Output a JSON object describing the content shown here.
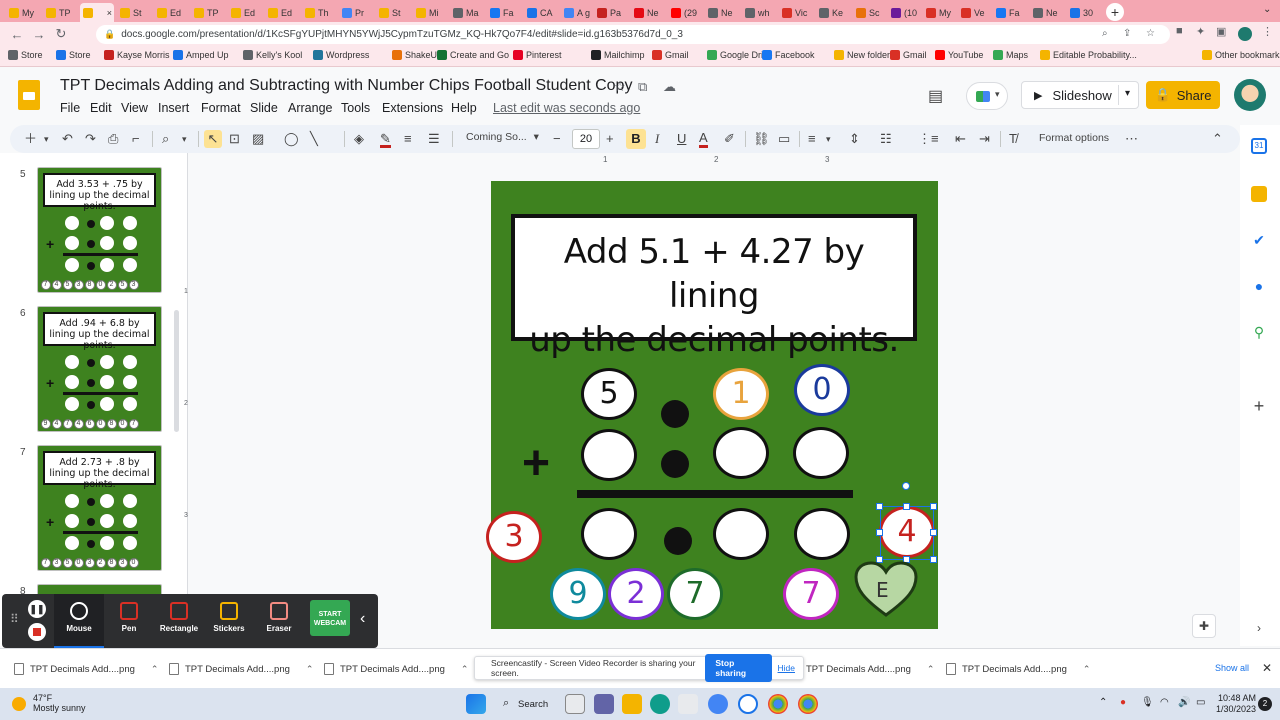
{
  "browser": {
    "tabs": [
      {
        "label": "My",
        "color": "#f4b400"
      },
      {
        "label": "TP",
        "color": "#f4b400"
      },
      {
        "label": "",
        "color": "#f4b400",
        "active": true
      },
      {
        "label": "St",
        "color": "#f4b400"
      },
      {
        "label": "Ed",
        "color": "#f4b400"
      },
      {
        "label": "TP",
        "color": "#f4b400"
      },
      {
        "label": "Ed",
        "color": "#f4b400"
      },
      {
        "label": "Ed",
        "color": "#f4b400"
      },
      {
        "label": "Th",
        "color": "#f4b400"
      },
      {
        "label": "Pr",
        "color": "#4285f4"
      },
      {
        "label": "St",
        "color": "#f4b400"
      },
      {
        "label": "Mi",
        "color": "#f4b400"
      },
      {
        "label": "Ma",
        "color": "#5f6368"
      },
      {
        "label": "Fa",
        "color": "#1877f2"
      },
      {
        "label": "CA",
        "color": "#1a73e8"
      },
      {
        "label": "A g",
        "color": "#4285f4"
      },
      {
        "label": "Pa",
        "color": "#c5221f"
      },
      {
        "label": "Ne",
        "color": "#e50914"
      },
      {
        "label": "(29",
        "color": "#ff0000"
      },
      {
        "label": "Ne",
        "color": "#5f6368"
      },
      {
        "label": "wh",
        "color": "#5f6368"
      },
      {
        "label": "Vic",
        "color": "#d93025"
      },
      {
        "label": "Ke",
        "color": "#5f6368"
      },
      {
        "label": "Sc",
        "color": "#e8710a"
      },
      {
        "label": "(10",
        "color": "#6a1b9a"
      },
      {
        "label": "My",
        "color": "#d93025"
      },
      {
        "label": "Ve",
        "color": "#d93025"
      },
      {
        "label": "Fa",
        "color": "#1877f2"
      },
      {
        "label": "Ne",
        "color": "#5f6368"
      },
      {
        "label": "30",
        "color": "#1a73e8"
      }
    ],
    "active_tab_close": "×",
    "new_tab": "+",
    "url": "docs.google.com/presentation/d/1KcSFgYUPjtMHYN5YWjJ5CypmTzuTGMz_KQ-Hk7Qo7F4/edit#slide=id.g163b5376d7d_0_3",
    "bookmarks": [
      {
        "label": "Store",
        "color": "#5f6368"
      },
      {
        "label": "Store",
        "color": "#1a73e8"
      },
      {
        "label": "Kayse Morris",
        "color": "#c5221f"
      },
      {
        "label": "Amped Up",
        "color": "#1a73e8"
      },
      {
        "label": "Kelly's Kool",
        "color": "#5f6368"
      },
      {
        "label": "Wordpress",
        "color": "#21759b"
      },
      {
        "label": "ShakeUp",
        "color": "#e8710a"
      },
      {
        "label": "Create and Go",
        "color": "#137333"
      },
      {
        "label": "Pinterest",
        "color": "#e60023"
      },
      {
        "label": "Mailchimp",
        "color": "#202124"
      },
      {
        "label": "Gmail",
        "color": "#d93025"
      },
      {
        "label": "Google Drive",
        "color": "#34a853"
      },
      {
        "label": "Facebook",
        "color": "#1877f2"
      },
      {
        "label": "New folder",
        "color": "#f4b400"
      },
      {
        "label": "Gmail",
        "color": "#d93025"
      },
      {
        "label": "YouTube",
        "color": "#ff0000"
      },
      {
        "label": "Maps",
        "color": "#34a853"
      },
      {
        "label": "Editable Probability...",
        "color": "#f4b400"
      },
      {
        "label": "Other bookmarks",
        "color": "#f4b400"
      }
    ]
  },
  "app": {
    "title": "TPT Decimals Adding and Subtracting with Number Chips Football Student Copy",
    "menus": [
      "File",
      "Edit",
      "View",
      "Insert",
      "Format",
      "Slide",
      "Arrange",
      "Tools",
      "Extensions",
      "Help"
    ],
    "last_edit": "Last edit was seconds ago",
    "slideshow_label": "Slideshow",
    "share_label": "Share",
    "brand_color": "#f4b400"
  },
  "toolbar": {
    "font": "Coming So...",
    "font_size": "20",
    "minus": "−",
    "plus": "+",
    "bold": "B",
    "italic": "I",
    "underline": "U",
    "text_color": "A",
    "format_options": "Format options",
    "more": "⋯"
  },
  "filmstrip": {
    "slides": [
      {
        "number": "5",
        "title": "Add 3.53 + .75 by lining up the decimal points.",
        "chips": [
          "7",
          "4",
          "5",
          "3",
          "8",
          "0",
          "2",
          "5",
          "3"
        ]
      },
      {
        "number": "6",
        "title": "Add .94 + 6.8 by lining up the decimal points.",
        "chips": [
          "9",
          "4",
          "7",
          "4",
          "6",
          "0",
          "8",
          "0",
          "7"
        ]
      },
      {
        "number": "7",
        "title": "Add 2.73 + .8 by lining up the decimal points.",
        "chips": [
          "7",
          "3",
          "5",
          "0",
          "3",
          "2",
          "8",
          "3",
          "0"
        ]
      },
      {
        "number": "8",
        "title": "",
        "chips": []
      }
    ]
  },
  "rulers": {
    "top": [
      "1",
      "2",
      "3"
    ],
    "left": [
      "1",
      "2",
      "3"
    ]
  },
  "slide": {
    "title_line1": "Add 5.1 + 4.27 by lining",
    "title_line2": "up the decimal points.",
    "plus_sign": "+",
    "background": "#3e821f",
    "top_row": [
      {
        "value": "5",
        "border": "#111111",
        "text": "#111111"
      },
      {
        "value": "1",
        "border": "#e8a33d",
        "text": "#e8a33d"
      },
      {
        "value": "0",
        "border": "#1a3a9c",
        "text": "#1a3a9c"
      }
    ],
    "left_chip": {
      "value": "3",
      "border": "#c5221f"
    },
    "selected_chip": {
      "value": "4",
      "border": "#c5221f"
    },
    "bottom_chips": [
      {
        "value": "9",
        "border": "#0f8a9d"
      },
      {
        "value": "2",
        "border": "#7b2fd6"
      },
      {
        "value": "7",
        "border": "#1e6b2a"
      },
      {
        "value": "7",
        "border": "#c026c0"
      }
    ],
    "heart_label": "E",
    "heart_color": "#b7d7a3"
  },
  "screencastify": {
    "tools": [
      {
        "label": "Mouse",
        "icon": "mouse-icon"
      },
      {
        "label": "Pen",
        "icon": "pen-icon"
      },
      {
        "label": "Rectangle",
        "icon": "rectangle-icon"
      },
      {
        "label": "Stickers",
        "icon": "sticker-icon"
      },
      {
        "label": "Eraser",
        "icon": "eraser-icon"
      }
    ],
    "webcam_label": "START WEBCAM",
    "collapse": "‹"
  },
  "downloads": {
    "items": [
      "TPT Decimals Add....png",
      "TPT Decimals Add....png",
      "TPT Decimals Add....png",
      "TPT Decimals Add....png",
      "TPT Decimals Add....png"
    ],
    "sharing_text": "Screencastify - Screen Video Recorder is sharing your screen.",
    "stop_sharing": "Stop sharing",
    "hide": "Hide",
    "show_all": "Show all"
  },
  "taskbar": {
    "weather_temp": "47°F",
    "weather_desc": "Mostly sunny",
    "search": "Search",
    "time": "10:48 AM",
    "date": "1/30/2023"
  }
}
